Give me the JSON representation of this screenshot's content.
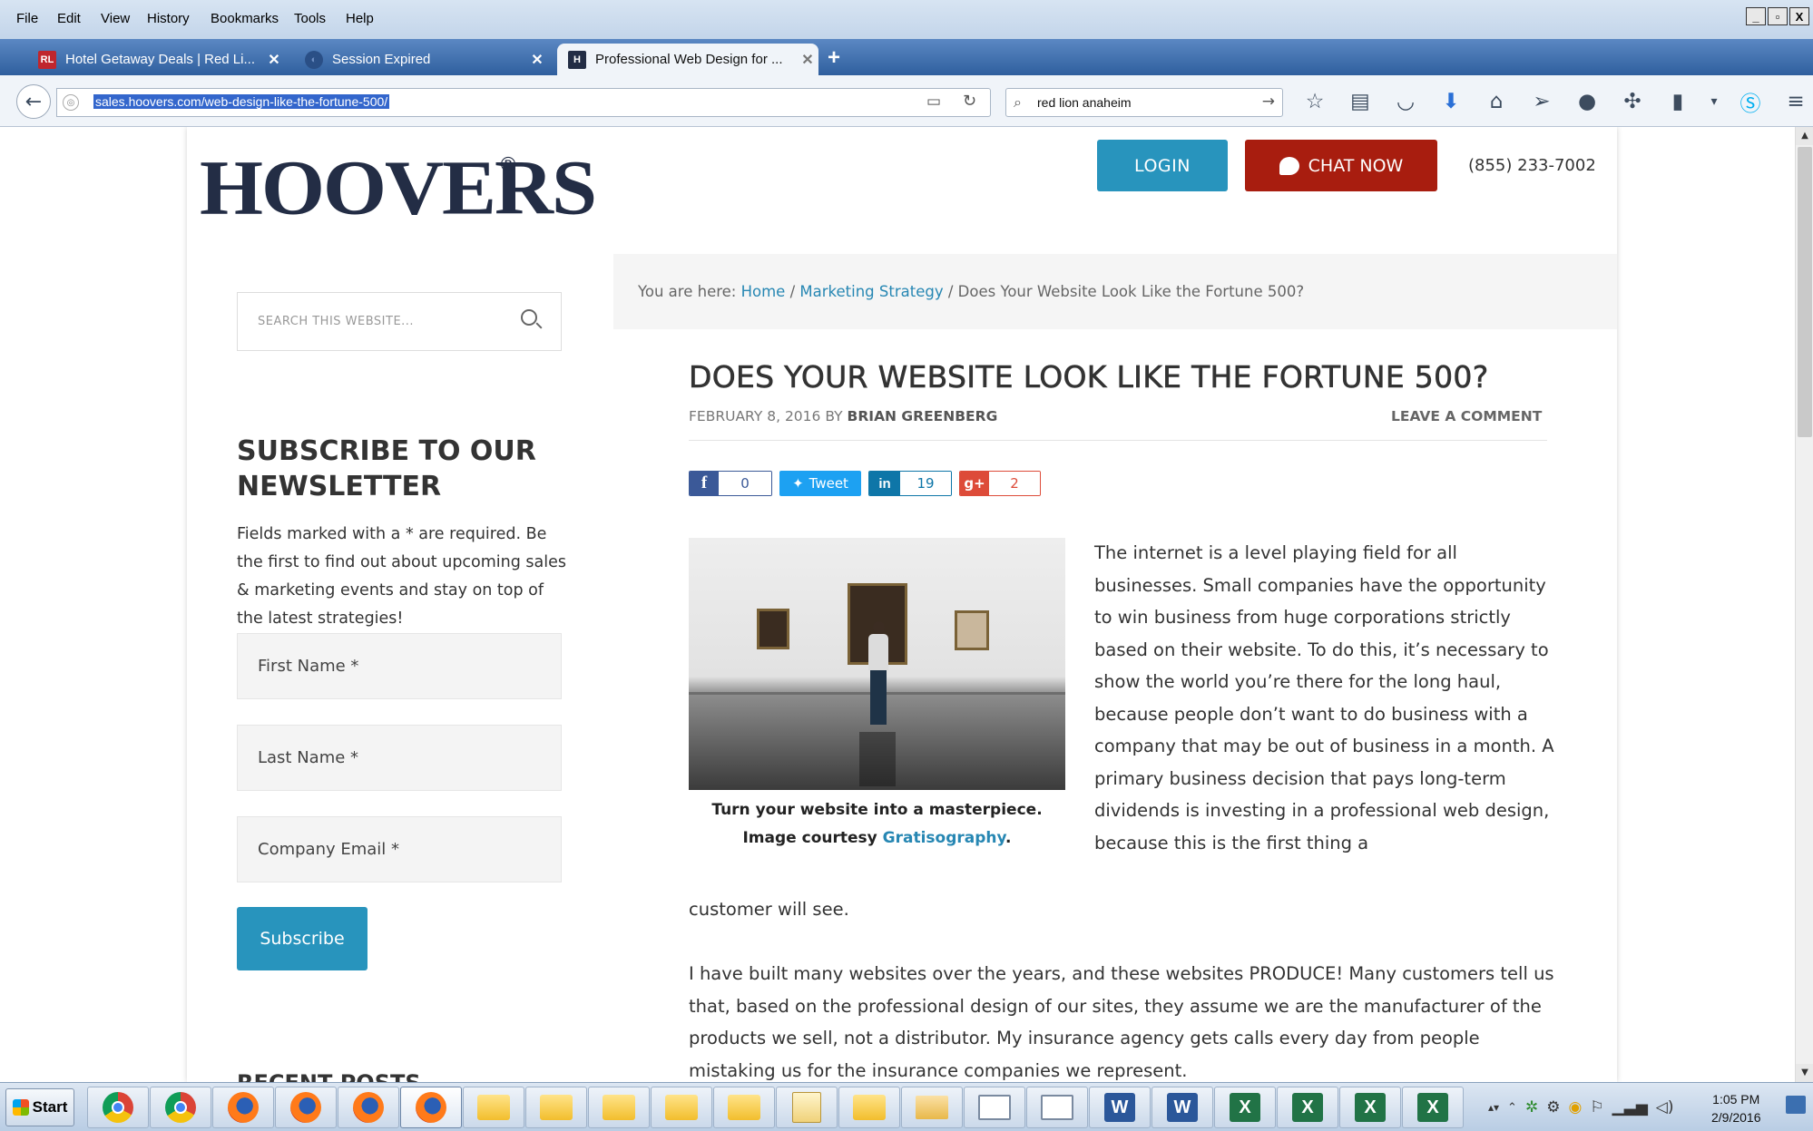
{
  "browser": {
    "menu": [
      "File",
      "Edit",
      "View",
      "History",
      "Bookmarks",
      "Tools",
      "Help"
    ],
    "window_controls": [
      "_",
      "▫",
      "X"
    ],
    "tabs": [
      {
        "title": "Hotel Getaway Deals | Red Li...",
        "icon": "red-lion-icon",
        "close": "✕"
      },
      {
        "title": "Session Expired",
        "icon": "moon-icon",
        "close": "✕"
      },
      {
        "title": "Professional Web Design for ...",
        "icon": "hoovers-icon",
        "close": "✕"
      }
    ],
    "new_tab": "+",
    "url": "sales.hoovers.com/web-design-like-the-fortune-500/",
    "search_value": "red lion anaheim"
  },
  "site": {
    "logo_text": "HOOVERS",
    "logo_reg": "®",
    "login_label": "LOGIN",
    "chat_label": "CHAT NOW",
    "phone": "(855) 233-7002"
  },
  "sidebar": {
    "search_placeholder": "SEARCH THIS WEBSITE...",
    "newsletter_title": "SUBSCRIBE TO OUR NEWSLETTER",
    "newsletter_desc": "Fields marked with a * are required. Be the first to find out about upcoming sales & marketing events and stay on top of the latest strategies!",
    "fields": [
      "First Name *",
      "Last Name *",
      "Company Email *"
    ],
    "subscribe_label": "Subscribe",
    "recent_posts": "RECENT POSTS"
  },
  "breadcrumb": {
    "prefix": "You are here:",
    "home": "Home",
    "sep": "/",
    "category": "Marketing Strategy",
    "current": "Does Your Website Look Like the Fortune 500?"
  },
  "post": {
    "title": "DOES YOUR WEBSITE LOOK LIKE THE FORTUNE 500?",
    "date": "FEBRUARY 8, 2016",
    "by": "BY",
    "author": "BRIAN GREENBERG",
    "leave_comment": "LEAVE A COMMENT",
    "share": {
      "facebook_count": "0",
      "tweet_label": "Tweet",
      "linkedin_count": "19",
      "gplus_count": "2"
    },
    "caption_line1": "Turn your website into a masterpiece.",
    "caption_line2_prefix": "Image courtesy",
    "caption_link": "Gratisography",
    "caption_end": ".",
    "para1": "The internet is a level playing field for all businesses. Small companies have the opportunity to win business from huge corporations strictly based on their website. To do this, it’s necessary to show the world you’re there for the long haul, because people don’t want to do business with a company that may be out of business in a month. A primary business decision that pays long-term dividends is investing in a professional web design, because this is the first thing a",
    "para1_cont": "customer will see.",
    "para2": "I have built many websites over the years, and these websites PRODUCE! Many customers tell us that, based on the professional design of our sites, they assume we are the manufacturer of the products we sell, not a distributor. My insurance agency gets calls every day from people mistaking us for the insurance companies we represent."
  },
  "taskbar": {
    "start_label": "Start",
    "apps": [
      "chrome",
      "chrome",
      "firefox",
      "firefox",
      "firefox",
      "firefox",
      "folder",
      "folder",
      "folder",
      "folder",
      "folder",
      "folder-edit",
      "folder",
      "mail",
      "window",
      "window",
      "word",
      "word",
      "excel",
      "excel",
      "excel",
      "excel"
    ],
    "word_glyph": "W",
    "excel_glyph": "X",
    "clock_time": "1:05 PM",
    "clock_date": "2/9/2016"
  },
  "colors": {
    "brand_navy": "#232d45",
    "accent_blue": "#2894bd",
    "chat_red": "#a81d0f",
    "link_blue": "#2787b3"
  }
}
